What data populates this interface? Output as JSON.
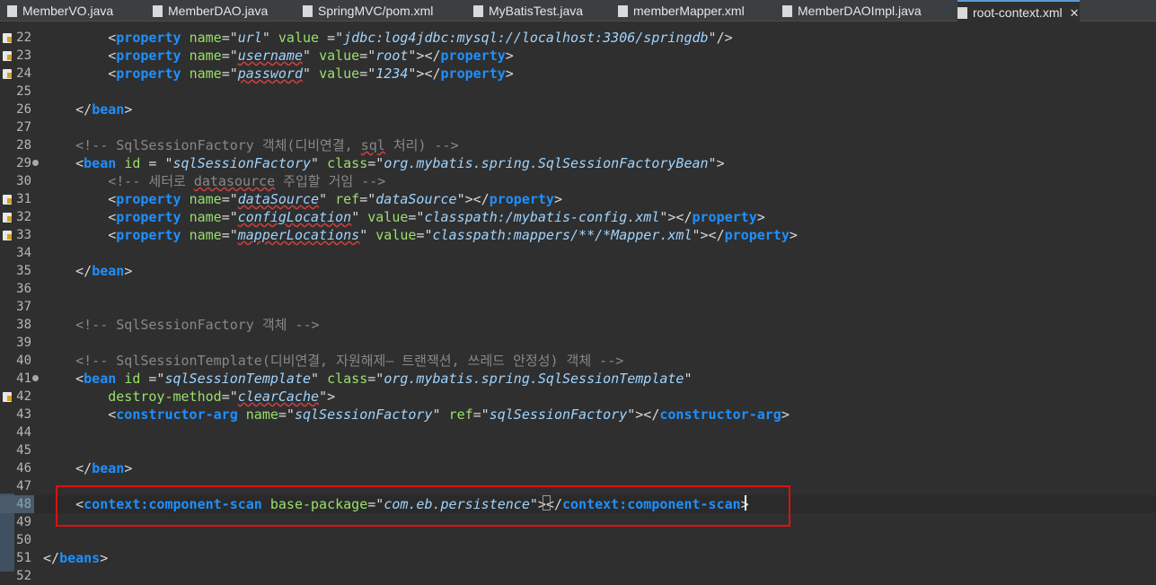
{
  "tabs": [
    {
      "label": "MemberVO.java",
      "icon": "java-file-icon"
    },
    {
      "label": "MemberDAO.java",
      "icon": "java-file-icon"
    },
    {
      "label": "SpringMVC/pom.xml",
      "icon": "maven-file-icon"
    },
    {
      "label": "MyBatisTest.java",
      "icon": "java-file-icon"
    },
    {
      "label": "memberMapper.xml",
      "icon": "xml-file-icon"
    },
    {
      "label": "MemberDAOImpl.java",
      "icon": "java-file-icon"
    },
    {
      "label": "root-context.xml",
      "icon": "xml-file-icon",
      "active": true,
      "close": "✕"
    }
  ],
  "lines": [
    {
      "n": "22",
      "ann": true,
      "tokens": [
        [
          "b",
          "        <"
        ],
        [
          "t",
          "property"
        ],
        [
          "b",
          " "
        ],
        [
          "a",
          "name"
        ],
        [
          "b",
          "=\""
        ],
        [
          "v",
          "url"
        ],
        [
          "b",
          "\" "
        ],
        [
          "a",
          "value"
        ],
        [
          "b",
          " =\""
        ],
        [
          "v",
          "jdbc:log4jdbc:mysql://localhost:3306/springdb"
        ],
        [
          "b",
          "\"/>"
        ]
      ]
    },
    {
      "n": "23",
      "ann": true,
      "tokens": [
        [
          "b",
          "        <"
        ],
        [
          "t",
          "property"
        ],
        [
          "b",
          " "
        ],
        [
          "a",
          "name"
        ],
        [
          "b",
          "=\""
        ],
        [
          "v s",
          "username"
        ],
        [
          "b",
          "\" "
        ],
        [
          "a",
          "value"
        ],
        [
          "b",
          "=\""
        ],
        [
          "v",
          "root"
        ],
        [
          "b",
          "\"></"
        ],
        [
          "t",
          "property"
        ],
        [
          "b",
          ">"
        ]
      ]
    },
    {
      "n": "24",
      "ann": true,
      "tokens": [
        [
          "b",
          "        <"
        ],
        [
          "t",
          "property"
        ],
        [
          "b",
          " "
        ],
        [
          "a",
          "name"
        ],
        [
          "b",
          "=\""
        ],
        [
          "v s",
          "password"
        ],
        [
          "b",
          "\" "
        ],
        [
          "a",
          "value"
        ],
        [
          "b",
          "=\""
        ],
        [
          "v",
          "1234"
        ],
        [
          "b",
          "\"></"
        ],
        [
          "t",
          "property"
        ],
        [
          "b",
          ">"
        ]
      ]
    },
    {
      "n": "25",
      "tokens": []
    },
    {
      "n": "26",
      "tokens": [
        [
          "b",
          "    </"
        ],
        [
          "t",
          "bean"
        ],
        [
          "b",
          ">"
        ]
      ]
    },
    {
      "n": "27",
      "tokens": []
    },
    {
      "n": "28",
      "tokens": [
        [
          "c",
          "    <!-- SqlSessionFactory 객체(디비연결, "
        ],
        [
          "c s",
          "sql"
        ],
        [
          "c",
          " 처리) -->"
        ]
      ]
    },
    {
      "n": "29",
      "fold": true,
      "tokens": [
        [
          "b",
          "    <"
        ],
        [
          "t",
          "bean"
        ],
        [
          "b",
          " "
        ],
        [
          "a",
          "id"
        ],
        [
          "b",
          " = \""
        ],
        [
          "v",
          "sqlSessionFactory"
        ],
        [
          "b",
          "\" "
        ],
        [
          "a",
          "class"
        ],
        [
          "b",
          "=\""
        ],
        [
          "v",
          "org.mybatis.spring.SqlSessionFactoryBean"
        ],
        [
          "b",
          "\">"
        ]
      ]
    },
    {
      "n": "30",
      "tokens": [
        [
          "c",
          "        <!-- 세터로 "
        ],
        [
          "c s",
          "datasource"
        ],
        [
          "c",
          " 주입할 거임 -->"
        ]
      ]
    },
    {
      "n": "31",
      "ann": true,
      "tokens": [
        [
          "b",
          "        <"
        ],
        [
          "t",
          "property"
        ],
        [
          "b",
          " "
        ],
        [
          "a",
          "name"
        ],
        [
          "b",
          "=\""
        ],
        [
          "v s",
          "dataSource"
        ],
        [
          "b",
          "\" "
        ],
        [
          "a",
          "ref"
        ],
        [
          "b",
          "=\""
        ],
        [
          "v",
          "dataSource"
        ],
        [
          "b",
          "\"></"
        ],
        [
          "t",
          "property"
        ],
        [
          "b",
          ">"
        ]
      ]
    },
    {
      "n": "32",
      "ann": true,
      "tokens": [
        [
          "b",
          "        <"
        ],
        [
          "t",
          "property"
        ],
        [
          "b",
          " "
        ],
        [
          "a",
          "name"
        ],
        [
          "b",
          "=\""
        ],
        [
          "v s",
          "configLocation"
        ],
        [
          "b",
          "\" "
        ],
        [
          "a",
          "value"
        ],
        [
          "b",
          "=\""
        ],
        [
          "v",
          "classpath:/mybatis-config.xml"
        ],
        [
          "b",
          "\"></"
        ],
        [
          "t",
          "property"
        ],
        [
          "b",
          ">"
        ]
      ]
    },
    {
      "n": "33",
      "ann": true,
      "tokens": [
        [
          "b",
          "        <"
        ],
        [
          "t",
          "property"
        ],
        [
          "b",
          " "
        ],
        [
          "a",
          "name"
        ],
        [
          "b",
          "=\""
        ],
        [
          "v s",
          "mapperLocations"
        ],
        [
          "b",
          "\" "
        ],
        [
          "a",
          "value"
        ],
        [
          "b",
          "=\""
        ],
        [
          "v",
          "classpath:mappers/**/*Mapper.xml"
        ],
        [
          "b",
          "\"></"
        ],
        [
          "t",
          "property"
        ],
        [
          "b",
          ">"
        ]
      ]
    },
    {
      "n": "34",
      "tokens": []
    },
    {
      "n": "35",
      "tokens": [
        [
          "b",
          "    </"
        ],
        [
          "t",
          "bean"
        ],
        [
          "b",
          ">"
        ]
      ]
    },
    {
      "n": "36",
      "tokens": []
    },
    {
      "n": "37",
      "tokens": []
    },
    {
      "n": "38",
      "tokens": [
        [
          "c",
          "    <!-- SqlSessionFactory 객체 -->"
        ]
      ]
    },
    {
      "n": "39",
      "tokens": []
    },
    {
      "n": "40",
      "tokens": [
        [
          "c",
          "    <!-- SqlSessionTemplate(디비연결, 자원해제— 트랜잭션, 쓰레드 안정성) 객체 -->"
        ]
      ]
    },
    {
      "n": "41",
      "fold": true,
      "tokens": [
        [
          "b",
          "    <"
        ],
        [
          "t",
          "bean"
        ],
        [
          "b",
          " "
        ],
        [
          "a",
          "id"
        ],
        [
          "b",
          " =\""
        ],
        [
          "v",
          "sqlSessionTemplate"
        ],
        [
          "b",
          "\" "
        ],
        [
          "a",
          "class"
        ],
        [
          "b",
          "=\""
        ],
        [
          "v",
          "org.mybatis.spring.SqlSessionTemplate"
        ],
        [
          "b",
          "\""
        ]
      ]
    },
    {
      "n": "42",
      "ann": true,
      "tokens": [
        [
          "b",
          "        "
        ],
        [
          "a",
          "destroy-method"
        ],
        [
          "b",
          "=\""
        ],
        [
          "v s",
          "clearCache"
        ],
        [
          "b",
          "\">"
        ]
      ]
    },
    {
      "n": "43",
      "tokens": [
        [
          "b",
          "        <"
        ],
        [
          "t",
          "constructor-arg"
        ],
        [
          "b",
          " "
        ],
        [
          "a",
          "name"
        ],
        [
          "b",
          "=\""
        ],
        [
          "v",
          "sqlSessionFactory"
        ],
        [
          "b",
          "\" "
        ],
        [
          "a",
          "ref"
        ],
        [
          "b",
          "=\""
        ],
        [
          "v",
          "sqlSessionFactory"
        ],
        [
          "b",
          "\"></"
        ],
        [
          "t",
          "constructor-arg"
        ],
        [
          "b",
          ">"
        ]
      ]
    },
    {
      "n": "44",
      "tokens": []
    },
    {
      "n": "45",
      "tokens": []
    },
    {
      "n": "46",
      "tokens": [
        [
          "b",
          "    </"
        ],
        [
          "t",
          "bean"
        ],
        [
          "b",
          ">"
        ]
      ]
    },
    {
      "n": "47",
      "tokens": []
    },
    {
      "n": "48",
      "current": true,
      "tokens": [
        [
          "b",
          "    <"
        ],
        [
          "t",
          "context:component-scan"
        ],
        [
          "b",
          " "
        ],
        [
          "a",
          "base-package"
        ],
        [
          "b",
          "=\""
        ],
        [
          "v",
          "com.eb.persistence"
        ],
        [
          "b",
          "\"></"
        ],
        [
          "t",
          "context:component-scan"
        ],
        [
          "b",
          ">"
        ]
      ]
    },
    {
      "n": "49",
      "tokens": []
    },
    {
      "n": "50",
      "tokens": []
    },
    {
      "n": "51",
      "tokens": [
        [
          "b",
          "</"
        ],
        [
          "t",
          "beans"
        ],
        [
          "b",
          ">"
        ]
      ]
    },
    {
      "n": "52",
      "tokens": []
    }
  ]
}
